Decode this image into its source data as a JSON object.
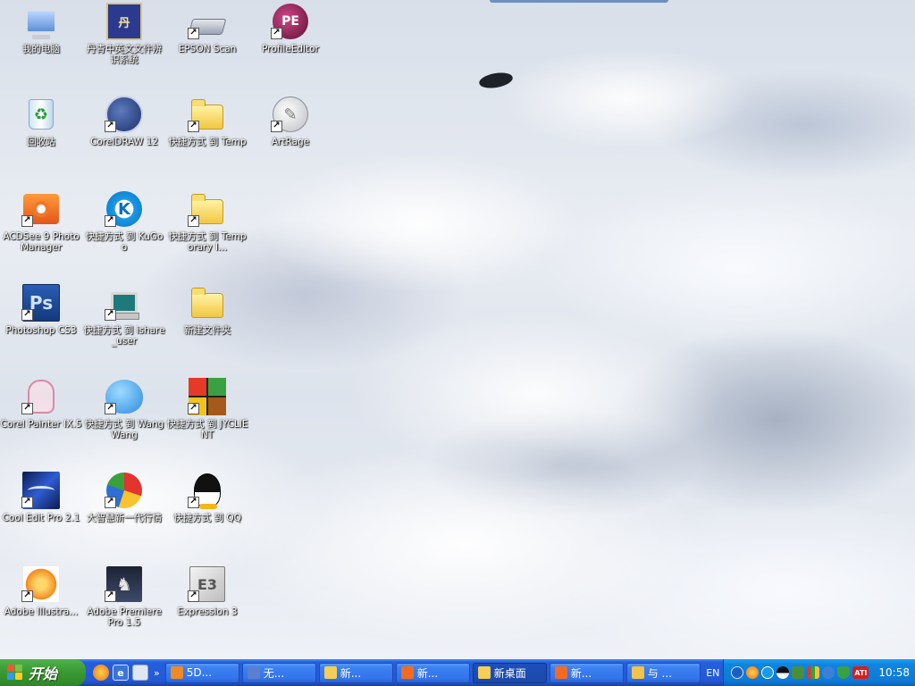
{
  "desktop": {
    "icons": [
      {
        "label": "我的电脑",
        "icon": "my-computer-icon"
      },
      {
        "label": "丹青中英文文件辨识系统",
        "icon": "ocr-app-icon"
      },
      {
        "label": "EPSON Scan",
        "icon": "scanner-icon"
      },
      {
        "label": "ProfileEditor",
        "icon": "profile-editor-icon"
      },
      {
        "label": "回收站",
        "icon": "recycle-bin-icon"
      },
      {
        "label": "CorelDRAW 12",
        "icon": "coreldraw-icon"
      },
      {
        "label": "快捷方式 到 Temp",
        "icon": "folder-icon"
      },
      {
        "label": "ArtRage",
        "icon": "artrage-icon"
      },
      {
        "label": "ACDSee 9 Photo Manager",
        "icon": "acdsee-icon"
      },
      {
        "label": "快捷方式 到 KuGoo",
        "icon": "kugoo-icon"
      },
      {
        "label": "快捷方式 到 Temporary I...",
        "icon": "folder-icon"
      },
      {
        "label": "Photoshop CS3",
        "icon": "photoshop-icon"
      },
      {
        "label": "快捷方式 到 ishare_user",
        "icon": "network-computer-icon"
      },
      {
        "label": "新建文件夹",
        "icon": "folder-icon"
      },
      {
        "label": "Corel Painter IX.5",
        "icon": "painter-icon"
      },
      {
        "label": "快捷方式 到 WangWang",
        "icon": "wangwang-icon"
      },
      {
        "label": "快捷方式 到 JYCLIENT",
        "icon": "jyclient-icon"
      },
      {
        "label": "Cool Edit Pro 2.1",
        "icon": "cool-edit-icon"
      },
      {
        "label": "大智慧新一代行情",
        "icon": "stock-app-icon"
      },
      {
        "label": "快捷方式 到 QQ",
        "icon": "qq-icon"
      },
      {
        "label": "Adobe Illustra...",
        "icon": "illustrator-icon"
      },
      {
        "label": "Adobe Premiere Pro 1.5",
        "icon": "premiere-icon"
      },
      {
        "label": "Expression 3",
        "icon": "expression-icon"
      }
    ]
  },
  "taskbar": {
    "start_label": "开始",
    "quick_launch_more": "»",
    "tasks": [
      {
        "label": "5D...",
        "icon": "firefox-icon",
        "color": "#f08a24",
        "active": false
      },
      {
        "label": "无...",
        "icon": "document-icon",
        "color": "#5b7fd0",
        "active": false
      },
      {
        "label": "新...",
        "icon": "folder-icon",
        "color": "#f3cf57",
        "active": false
      },
      {
        "label": "新...",
        "icon": "acdsee-icon",
        "color": "#f26b22",
        "active": false
      },
      {
        "label": "新桌面",
        "icon": "folder-icon",
        "color": "#f3cf57",
        "active": true
      },
      {
        "label": "新...",
        "icon": "acdsee-icon",
        "color": "#f26b22",
        "active": false
      },
      {
        "label": "与 ...",
        "icon": "chat-icon",
        "color": "#f3c34a",
        "active": false
      }
    ],
    "language": "EN",
    "clock": "10:58"
  }
}
